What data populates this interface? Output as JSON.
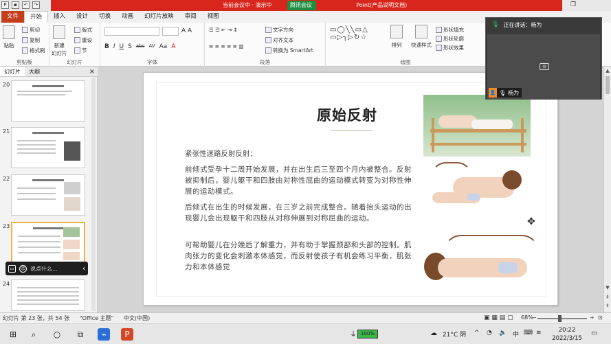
{
  "titlebar": {
    "banner_text": "当前会议中 · 演示中",
    "meeting_label": "腾讯会议",
    "doc_title": "Point(产品说明文档)"
  },
  "ribbon_tabs": [
    "文件",
    "开始",
    "插入",
    "设计",
    "切换",
    "动画",
    "幻灯片放映",
    "审阅",
    "视图"
  ],
  "ribbon": {
    "paste": "粘贴",
    "cut": "剪切",
    "copy": "复制",
    "format_painter": "格式刷",
    "clipboard_label": "剪贴板",
    "new_slide": "新建\n幻灯片",
    "layout": "版式",
    "reset": "重设",
    "section": "节",
    "slides_label": "幻灯片",
    "font_label": "字体",
    "text_direction": "文字方向",
    "align_text": "对齐文本",
    "convert_smartart": "转换为 SmartArt",
    "paragraph_label": "段落",
    "arrange": "排列",
    "quick_styles": "快速样式",
    "shape_fill": "形状填充",
    "shape_outline": "形状轮廓",
    "shape_effects": "形状效果",
    "drawing_label": "绘图",
    "format_buttons": [
      "B",
      "I",
      "U",
      "S",
      "abc",
      "AV",
      "Aa",
      "A"
    ]
  },
  "slide_panel": {
    "tab_slides": "幻灯片",
    "tab_outline": "大纲",
    "close": "×",
    "thumbs": [
      {
        "num": "20"
      },
      {
        "num": "21"
      },
      {
        "num": "22"
      },
      {
        "num": "23"
      },
      {
        "num": "24"
      }
    ]
  },
  "chat": {
    "placeholder": "说点什么...",
    "arrow": "‹"
  },
  "slide": {
    "title": "原始反射",
    "subtitle": "紧张性迷路反射反射：",
    "para1": "前倾式受孕十二周开始发展，并在出生后三至四个月内被整合。反射被抑制后，婴儿躯干和四肢由对称性屈曲的运动模式转变为对称性伸展的运动模式。",
    "para2": "后倾式在出生的时候发展，在三岁之前完成整合。随着抬头运动的出现婴儿会出现躯干和四肢从对称伸展到对称屈曲的运动。",
    "para3": "可帮助婴儿在分娩后了解重力，并有助于掌握颈部和头部的控制。肌肉张力的变化会刺激本体感觉，而反射使孩子有机会练习平衡，肌张力和本体感觉"
  },
  "meeting": {
    "speaking_label": "正在讲话：杨为",
    "name": "杨为"
  },
  "statusbar": {
    "slide_info": "幻灯片 第 23 张，共 54 张",
    "theme": "\"Office 主题\"",
    "language": "中文(中国)",
    "zoom": "68%"
  },
  "taskbar": {
    "battery": "100%",
    "battery_level": 1.0,
    "weather": "21°C  阴",
    "ime": "中",
    "time": "20:22",
    "date": "2022/3/15"
  }
}
